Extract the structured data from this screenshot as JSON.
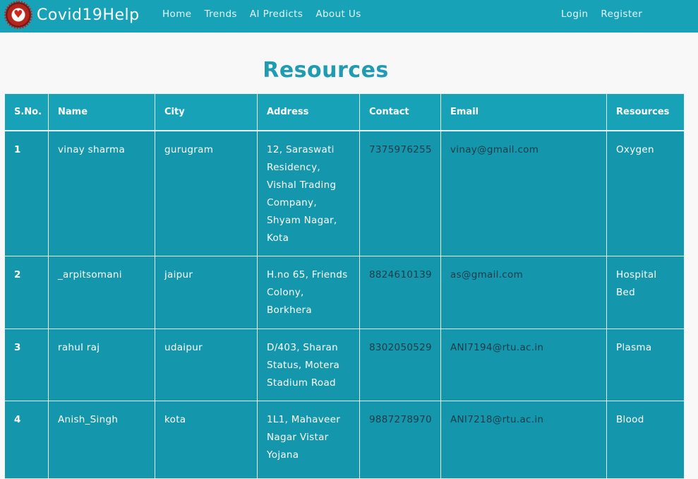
{
  "brand": {
    "name": "Covid19Help"
  },
  "nav": {
    "links": [
      "Home",
      "Trends",
      "AI Predicts",
      "About Us"
    ],
    "auth": [
      "Login",
      "Register"
    ]
  },
  "page": {
    "title": "Resources"
  },
  "table": {
    "headers": [
      "S.No.",
      "Name",
      "City",
      "Address",
      "Contact",
      "Email",
      "Resources"
    ],
    "rows": [
      {
        "sno": "1",
        "name": "vinay sharma",
        "city": "gurugram",
        "address": "12, Saraswati Residency, Vishal Trading Company, Shyam Nagar, Kota",
        "contact": "7375976255",
        "email": "vinay@gmail.com",
        "resource": "Oxygen"
      },
      {
        "sno": "2",
        "name": "_arpitsomani",
        "city": "jaipur",
        "address": "H.no 65, Friends Colony, Borkhera",
        "contact": "8824610139",
        "email": "as@gmail.com",
        "resource": "Hospital Bed"
      },
      {
        "sno": "3",
        "name": "rahul raj",
        "city": "udaipur",
        "address": "D/403, Sharan Status, Motera Stadium Road",
        "contact": "8302050529",
        "email": "ANI7194@rtu.ac.in",
        "resource": "Plasma"
      },
      {
        "sno": "4",
        "name": "Anish_Singh",
        "city": "kota",
        "address": "1L1, Mahaveer Nagar Vistar Yojana",
        "contact": "9887278970",
        "email": "ANI7218@rtu.ac.in",
        "resource": "Blood"
      }
    ]
  },
  "colors": {
    "navbar": "#17a2b8",
    "title": "#1f9bb2",
    "table_cell": "#1497ad"
  }
}
